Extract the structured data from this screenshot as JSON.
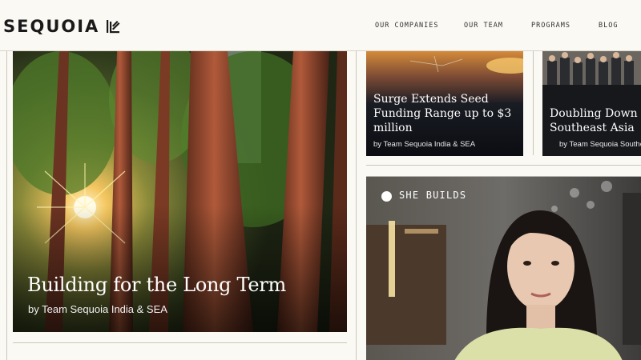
{
  "header": {
    "logo_text": "SEQUOIA",
    "nav": [
      {
        "label": "OUR COMPANIES"
      },
      {
        "label": "OUR TEAM"
      },
      {
        "label": "PROGRAMS"
      },
      {
        "label": "BLOG"
      }
    ]
  },
  "hero": {
    "title": "Building for the Long Term",
    "byline": "by Team Sequoia India & SEA"
  },
  "cards": [
    {
      "title_lines": [
        "Surge Extends Seed",
        "Funding Range up to $3",
        "million"
      ],
      "byline": "by Team Sequoia India & SEA"
    },
    {
      "title_lines": [
        "Doubling Down",
        "Southeast Asia"
      ],
      "byline": "by Team Sequoia Southeast"
    }
  ],
  "video": {
    "label": "SHE BUILDS"
  },
  "colors": {
    "background": "#fbf9f3",
    "text_dark": "#1a1a1a",
    "card_dark": "#0d0f14"
  }
}
